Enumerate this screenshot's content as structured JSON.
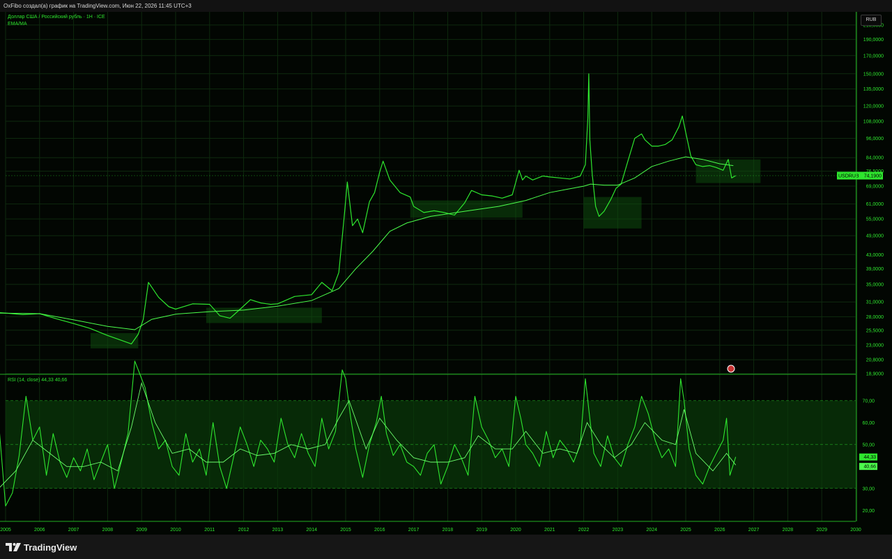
{
  "header": {
    "title": "OxFibo создал(а) график на TradingView.com, Июн 22, 2026 11:45 UTC+3"
  },
  "main_pane": {
    "symbol_legend": "Доллар США / Российский рубль · 1Н · ICE",
    "indicator_legend": "EMA/MA",
    "currency_button": "RUB",
    "price_tag_symbol": "USDRUB",
    "price_tag_value": "74,1900"
  },
  "rsi_pane": {
    "legend": "RSI (14, close)  44,33  40,66",
    "tag_rsi": "44,33",
    "tag_ma": "40,66"
  },
  "footer": {
    "brand": "TradingView"
  },
  "colors": {
    "accent": "#2ee62e",
    "grid": "#0e2a0e",
    "box": "#0e4a0e",
    "bg": "#020602"
  },
  "chart_data": [
    {
      "type": "line",
      "log_scale": true,
      "ylim": [
        18.9,
        230
      ],
      "y_ticks": [
        "210,0000",
        "190,0000",
        "170,0000",
        "150,0000",
        "135,0000",
        "120,0000",
        "108,0000",
        "96,0000",
        "84,0000",
        "76,5000",
        "69,0000",
        "61,0000",
        "55,0000",
        "49,0000",
        "43,0000",
        "39,0000",
        "35,0000",
        "31,0000",
        "28,0000",
        "25,5000",
        "23,0000",
        "20,8000",
        "18,9000"
      ],
      "y_tick_values": [
        210,
        190,
        170,
        150,
        135,
        120,
        108,
        96,
        84,
        76.5,
        69,
        61,
        55,
        49,
        43,
        39,
        35,
        31,
        28,
        25.5,
        23,
        20.8,
        18.9
      ],
      "x_ticks": [
        "2005",
        "2006",
        "2007",
        "2008",
        "2009",
        "2010",
        "2011",
        "2012",
        "2013",
        "2014",
        "2015",
        "2016",
        "2017",
        "2018",
        "2019",
        "2020",
        "2021",
        "2022",
        "2023",
        "2024",
        "2025",
        "2026",
        "2027",
        "2028",
        "2029",
        "2030"
      ],
      "xlim": [
        2005.0,
        2030.0
      ],
      "series": [
        {
          "x": [
            2004.8,
            2005.0,
            2005.5,
            2006.0,
            2006.5,
            2007.0,
            2007.5,
            2008.0,
            2008.3,
            2008.5,
            2008.7,
            2008.9,
            2009.05,
            2009.2,
            2009.5,
            2009.8,
            2010.0,
            2010.5,
            2011.0,
            2011.3,
            2011.6,
            2011.9,
            2012.2,
            2012.5,
            2012.8,
            2013.0,
            2013.5,
            2014.0,
            2014.3,
            2014.6,
            2014.8,
            2014.95,
            2015.05,
            2015.2,
            2015.35,
            2015.5,
            2015.7,
            2015.85,
            2016.0,
            2016.1,
            2016.3,
            2016.6,
            2016.9,
            2017.0,
            2017.3,
            2017.6,
            2017.9,
            2018.2,
            2018.5,
            2018.7,
            2019.0,
            2019.3,
            2019.6,
            2019.9,
            2020.1,
            2020.2,
            2020.3,
            2020.5,
            2020.8,
            2021.0,
            2021.3,
            2021.6,
            2021.9,
            2022.05,
            2022.12,
            2022.15,
            2022.18,
            2022.25,
            2022.35,
            2022.45,
            2022.6,
            2022.8,
            2022.95,
            2023.1,
            2023.3,
            2023.5,
            2023.7,
            2023.8,
            2024.0,
            2024.2,
            2024.4,
            2024.6,
            2024.8,
            2024.9,
            2025.0,
            2025.15,
            2025.3,
            2025.5,
            2025.7,
            2025.9,
            2026.1,
            2026.25,
            2026.35,
            2026.47
          ],
          "y": [
            28.8,
            28.7,
            28.4,
            28.6,
            27.6,
            26.7,
            25.8,
            24.6,
            24.0,
            23.6,
            23.2,
            24.8,
            27.5,
            35.5,
            32.0,
            30.0,
            29.5,
            30.6,
            30.5,
            28.2,
            27.7,
            29.5,
            31.5,
            30.8,
            30.5,
            30.6,
            32.2,
            32.6,
            35.5,
            33.5,
            38.0,
            55.0,
            71.0,
            52.5,
            55.0,
            50.0,
            62.0,
            66.0,
            76.0,
            82.0,
            72.0,
            66.0,
            64.0,
            60.0,
            57.5,
            58.2,
            57.5,
            56.5,
            61.5,
            67.0,
            65.0,
            64.5,
            63.5,
            65.0,
            77.0,
            72.0,
            74.0,
            72.0,
            74.0,
            73.5,
            73.0,
            72.5,
            74.0,
            80.0,
            110.0,
            150.0,
            95.0,
            75.0,
            60.0,
            56.0,
            58.0,
            63.0,
            68.0,
            70.0,
            82.0,
            96.0,
            99.0,
            95.0,
            91.0,
            91.0,
            92.0,
            95.0,
            104.0,
            112.0,
            100.0,
            85.0,
            80.0,
            79.0,
            79.5,
            78.5,
            77.0,
            83.0,
            73.0,
            74.19
          ]
        },
        {
          "name": "EMA/MA",
          "x": [
            2004.8,
            2006.0,
            2007.0,
            2008.0,
            2008.8,
            2009.3,
            2010.0,
            2011.0,
            2012.0,
            2013.0,
            2014.0,
            2014.8,
            2015.3,
            2015.8,
            2016.3,
            2016.8,
            2017.5,
            2018.5,
            2019.5,
            2020.3,
            2021.0,
            2021.5,
            2022.0,
            2022.2,
            2022.6,
            2023.0,
            2023.5,
            2024.0,
            2024.5,
            2025.0,
            2025.5,
            2026.0,
            2026.4
          ],
          "y": [
            28.7,
            28.6,
            27.4,
            26.2,
            25.6,
            27.5,
            28.5,
            29.0,
            29.3,
            30.1,
            31.3,
            34.0,
            39.0,
            44.0,
            50.5,
            53.5,
            56.0,
            58.0,
            60.0,
            62.5,
            66.0,
            67.5,
            69.0,
            70.0,
            69.5,
            69.5,
            73.0,
            79.0,
            82.0,
            84.5,
            83.0,
            80.5,
            79.5
          ]
        }
      ],
      "highlight_boxes": [
        {
          "x": [
            2007.5,
            2008.9
          ],
          "y": [
            22.5,
            25.0
          ]
        },
        {
          "x": [
            2010.9,
            2014.3
          ],
          "y": [
            26.8,
            29.8
          ]
        },
        {
          "x": [
            2016.9,
            2020.2
          ],
          "y": [
            55.5,
            62.5
          ]
        },
        {
          "x": [
            2022.0,
            2023.7
          ],
          "y": [
            51.5,
            64.0
          ]
        },
        {
          "x": [
            2025.3,
            2027.2
          ],
          "y": [
            70.5,
            83.0
          ]
        }
      ],
      "last_price": 74.19
    },
    {
      "type": "line",
      "title": "RSI (14, close)",
      "ylim": [
        15,
        82
      ],
      "y_ticks": [
        "70,00",
        "60,00",
        "50,00",
        "40,00",
        "30,00",
        "20,00"
      ],
      "y_tick_values": [
        70,
        60,
        50,
        40,
        30,
        20
      ],
      "band": [
        30,
        70
      ],
      "xlim": [
        2005.0,
        2030.0
      ],
      "series": [
        {
          "x": [
            2004.8,
            2005.0,
            2005.2,
            2005.4,
            2005.6,
            2005.8,
            2006.0,
            2006.2,
            2006.4,
            2006.6,
            2006.8,
            2007.0,
            2007.2,
            2007.4,
            2007.6,
            2007.8,
            2008.0,
            2008.2,
            2008.4,
            2008.6,
            2008.8,
            2008.95,
            2009.1,
            2009.3,
            2009.5,
            2009.7,
            2009.9,
            2010.1,
            2010.3,
            2010.5,
            2010.7,
            2010.9,
            2011.1,
            2011.3,
            2011.5,
            2011.7,
            2011.9,
            2012.1,
            2012.3,
            2012.5,
            2012.7,
            2012.9,
            2013.1,
            2013.3,
            2013.5,
            2013.7,
            2013.9,
            2014.1,
            2014.3,
            2014.5,
            2014.7,
            2014.9,
            2015.0,
            2015.15,
            2015.3,
            2015.5,
            2015.7,
            2015.9,
            2016.05,
            2016.2,
            2016.4,
            2016.6,
            2016.8,
            2017.0,
            2017.2,
            2017.4,
            2017.6,
            2017.8,
            2018.0,
            2018.2,
            2018.4,
            2018.6,
            2018.8,
            2019.0,
            2019.2,
            2019.4,
            2019.6,
            2019.8,
            2020.0,
            2020.15,
            2020.3,
            2020.5,
            2020.7,
            2020.9,
            2021.1,
            2021.3,
            2021.5,
            2021.7,
            2021.9,
            2022.05,
            2022.15,
            2022.3,
            2022.5,
            2022.7,
            2022.9,
            2023.1,
            2023.3,
            2023.5,
            2023.7,
            2023.9,
            2024.1,
            2024.3,
            2024.5,
            2024.7,
            2024.85,
            2024.95,
            2025.1,
            2025.3,
            2025.5,
            2025.7,
            2025.9,
            2026.1,
            2026.2,
            2026.3,
            2026.47
          ],
          "y": [
            60,
            22,
            28,
            45,
            72,
            52,
            58,
            36,
            55,
            42,
            35,
            44,
            38,
            48,
            34,
            42,
            50,
            30,
            42,
            55,
            88,
            82,
            76,
            60,
            48,
            52,
            40,
            36,
            55,
            42,
            48,
            36,
            60,
            40,
            30,
            44,
            58,
            50,
            40,
            52,
            48,
            42,
            62,
            50,
            44,
            55,
            46,
            40,
            62,
            48,
            56,
            84,
            80,
            62,
            48,
            35,
            50,
            60,
            72,
            55,
            45,
            50,
            42,
            40,
            36,
            46,
            50,
            32,
            40,
            50,
            44,
            36,
            72,
            58,
            52,
            44,
            48,
            40,
            72,
            62,
            50,
            46,
            40,
            56,
            44,
            52,
            48,
            42,
            50,
            80,
            66,
            46,
            40,
            54,
            44,
            40,
            50,
            58,
            72,
            64,
            52,
            44,
            48,
            40,
            80,
            70,
            48,
            36,
            32,
            40,
            46,
            52,
            62,
            36,
            44.33
          ]
        },
        {
          "name": "MA",
          "x": [
            2004.8,
            2005.3,
            2005.8,
            2006.3,
            2006.8,
            2007.3,
            2007.8,
            2008.3,
            2008.7,
            2009.0,
            2009.4,
            2009.9,
            2010.4,
            2010.9,
            2011.4,
            2011.9,
            2012.4,
            2012.9,
            2013.4,
            2013.9,
            2014.4,
            2014.8,
            2015.1,
            2015.6,
            2016.0,
            2016.5,
            2017.0,
            2017.5,
            2018.0,
            2018.5,
            2018.9,
            2019.4,
            2019.9,
            2020.3,
            2020.8,
            2021.3,
            2021.8,
            2022.1,
            2022.5,
            2022.9,
            2023.4,
            2023.8,
            2024.3,
            2024.7,
            2024.95,
            2025.3,
            2025.8,
            2026.2,
            2026.47
          ],
          "y": [
            30,
            38,
            52,
            46,
            40,
            40,
            42,
            38,
            58,
            78,
            60,
            46,
            48,
            42,
            42,
            48,
            45,
            46,
            50,
            48,
            50,
            62,
            70,
            48,
            62,
            52,
            44,
            42,
            42,
            44,
            54,
            48,
            48,
            56,
            46,
            48,
            46,
            60,
            50,
            44,
            50,
            60,
            52,
            50,
            66,
            46,
            38,
            46,
            40.66
          ]
        }
      ],
      "rsi_value": 44.33,
      "ma_value": 40.66
    }
  ]
}
